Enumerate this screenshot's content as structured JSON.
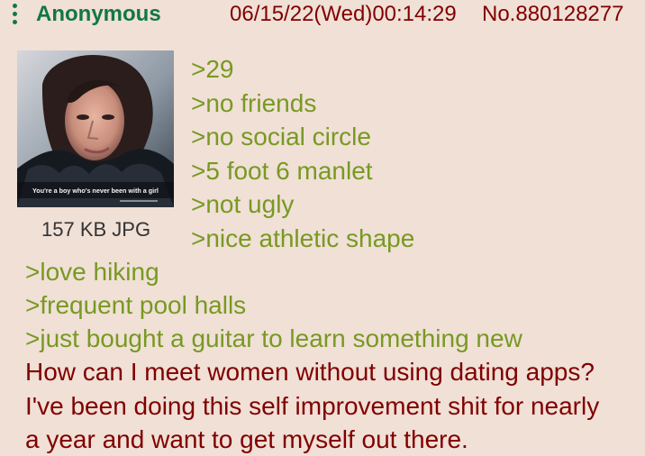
{
  "post": {
    "name": "Anonymous",
    "datetime": "06/15/22(Wed)00:14:29",
    "post_number": "No.880128277",
    "menu_icon": "vertical-ellipsis-icon"
  },
  "file": {
    "caption": "You're a boy who's never been with a girl",
    "info": "157 KB JPG"
  },
  "comment": {
    "greentext_lines": [
      ">29",
      ">no friends",
      ">no social circle",
      ">5 foot 6 manlet",
      ">not ugly",
      ">nice athletic shape",
      ">love hiking",
      ">frequent pool halls",
      ">just bought a guitar to learn something new"
    ],
    "body_lines": [
      "How can I meet women without using dating apps?",
      "I've been doing this self improvement shit for nearly",
      "a year and want to get myself out there."
    ]
  },
  "colors": {
    "background": "#f0e0d6",
    "name_green": "#117743",
    "greentext": "#789922",
    "text": "#800000"
  }
}
